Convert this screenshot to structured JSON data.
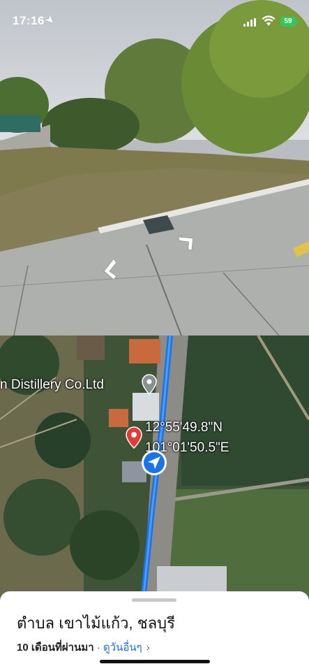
{
  "status_bar": {
    "time": "17:16",
    "battery": "59",
    "location_icon": "location-arrow-icon",
    "signal_icon": "cellular-signal-icon",
    "wifi_icon": "wifi-icon",
    "battery_color": "#34c759"
  },
  "street_view": {
    "nav_icons": [
      "chevron-left-arrow-icon",
      "chevron-right-arrow-icon"
    ]
  },
  "map": {
    "place_label": "n Distillery Co.Ltd",
    "coordinates": {
      "lat": "12°55'49.8\"N",
      "lon": "101°01'50.5\"E"
    },
    "pin_icon": "map-pin-icon",
    "grey_pin_icon": "place-marker-icon",
    "location_icon": "current-location-icon",
    "route_color": "#1a73e8"
  },
  "sheet": {
    "title": "ตำบล เขาไม้แก้ว, ชลบุรี",
    "count": "10",
    "date_text": " เดือนที่ผ่านมา",
    "separator": " · ",
    "link": "ดูวันอื่นๆ",
    "chevron": "›"
  }
}
